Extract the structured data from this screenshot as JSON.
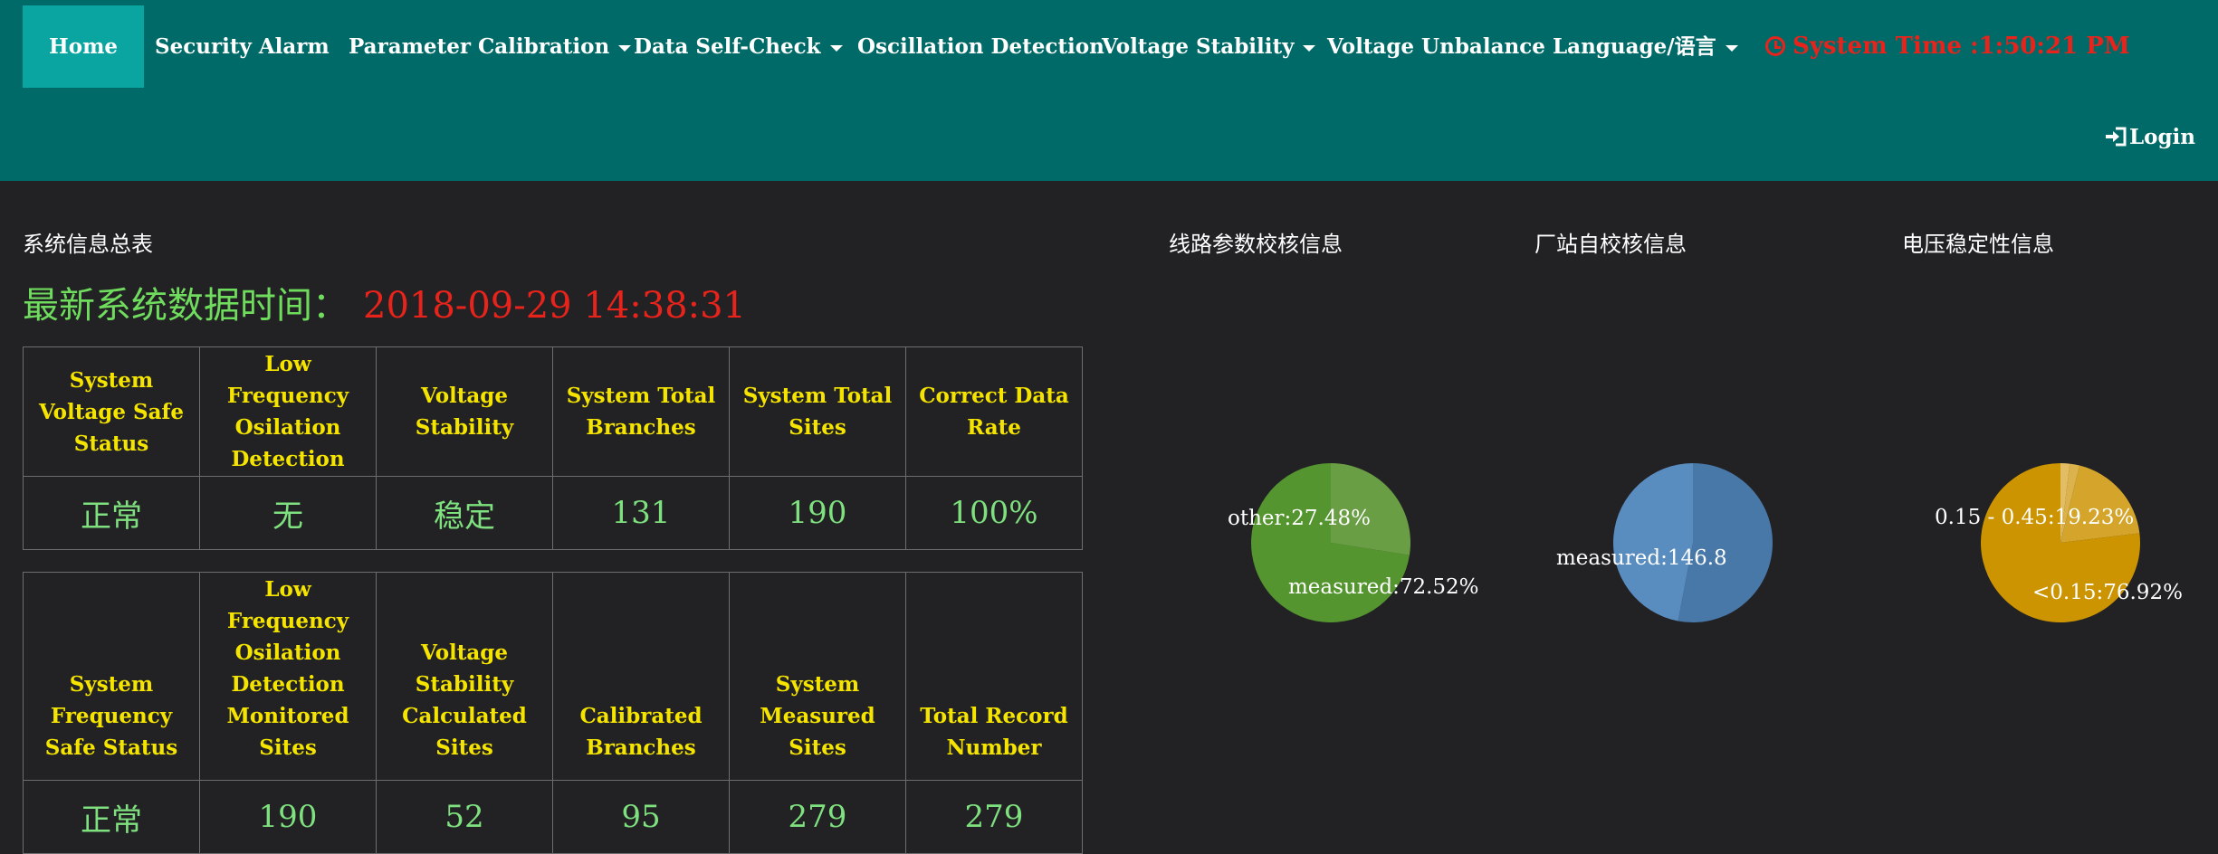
{
  "nav": {
    "home": "Home",
    "security_alarm": "Security Alarm",
    "parameter_calibration": "Parameter Calibration",
    "data_self_check": "Data Self-Check",
    "oscillation_detection": "Oscillation Detection",
    "voltage_stability": "Voltage Stability",
    "voltage_unbalance": "Voltage Unbalance",
    "language": "Language/语言",
    "system_time": "System Time :1:50:21 PM",
    "login": "Login"
  },
  "colors": {
    "navbar": "#006a68",
    "active_tab": "#0aa5a1",
    "background": "#222224",
    "header_text": "#f5e400",
    "value_text": "#7ee07e",
    "alert_text": "#e8231b"
  },
  "summary": {
    "title": "系统信息总表",
    "latest_label": "最新系统数据时间：",
    "latest_time": "2018-09-29 14:38:31",
    "table1": {
      "headers": [
        "System Voltage Safe Status",
        "Low Frequency Osilation Detection",
        "Voltage Stability",
        "System Total Branches",
        "System Total Sites",
        "Correct Data Rate"
      ],
      "values": [
        "正常",
        "无",
        "稳定",
        "131",
        "190",
        "100%"
      ]
    },
    "table2": {
      "headers": [
        "System Frequency Safe Status",
        "Low Frequency Osilation Detection Monitored Sites",
        "Voltage Stability Calculated Sites",
        "Calibrated Branches",
        "System Measured Sites",
        "Total Record Number"
      ],
      "values": [
        "正常",
        "190",
        "52",
        "95",
        "279",
        "279"
      ]
    }
  },
  "panels": {
    "line_params": {
      "title": "线路参数校核信息",
      "labels": [
        "other:27.48%",
        "measured:72.52%"
      ]
    },
    "station_check": {
      "title": "厂站自校核信息",
      "labels": [
        "measured:146.8"
      ]
    },
    "voltage_stability": {
      "title": "电压稳定性信息",
      "labels": [
        "0.15 - 0.45:19.23%",
        "<0.15:76.92%"
      ]
    }
  },
  "chart_data": [
    {
      "type": "pie",
      "title": "线路参数校核信息",
      "categories": [
        "measured",
        "other"
      ],
      "values": [
        72.52,
        27.48
      ],
      "colors": [
        "#559530",
        "#6a9e45"
      ]
    },
    {
      "type": "pie",
      "title": "厂站自校核信息",
      "categories": [
        "measured",
        ""
      ],
      "values": [
        53,
        47
      ],
      "colors": [
        "#4878a8",
        "#5a8dbf"
      ]
    },
    {
      "type": "pie",
      "title": "电压稳定性信息",
      "categories": [
        "<0.15",
        "0.15 - 0.45",
        "",
        ""
      ],
      "values": [
        76.92,
        19.23,
        2.0,
        1.85
      ],
      "colors": [
        "#cc9400",
        "#d4a52a",
        "#dcb24c",
        "#e2bd63"
      ]
    }
  ]
}
